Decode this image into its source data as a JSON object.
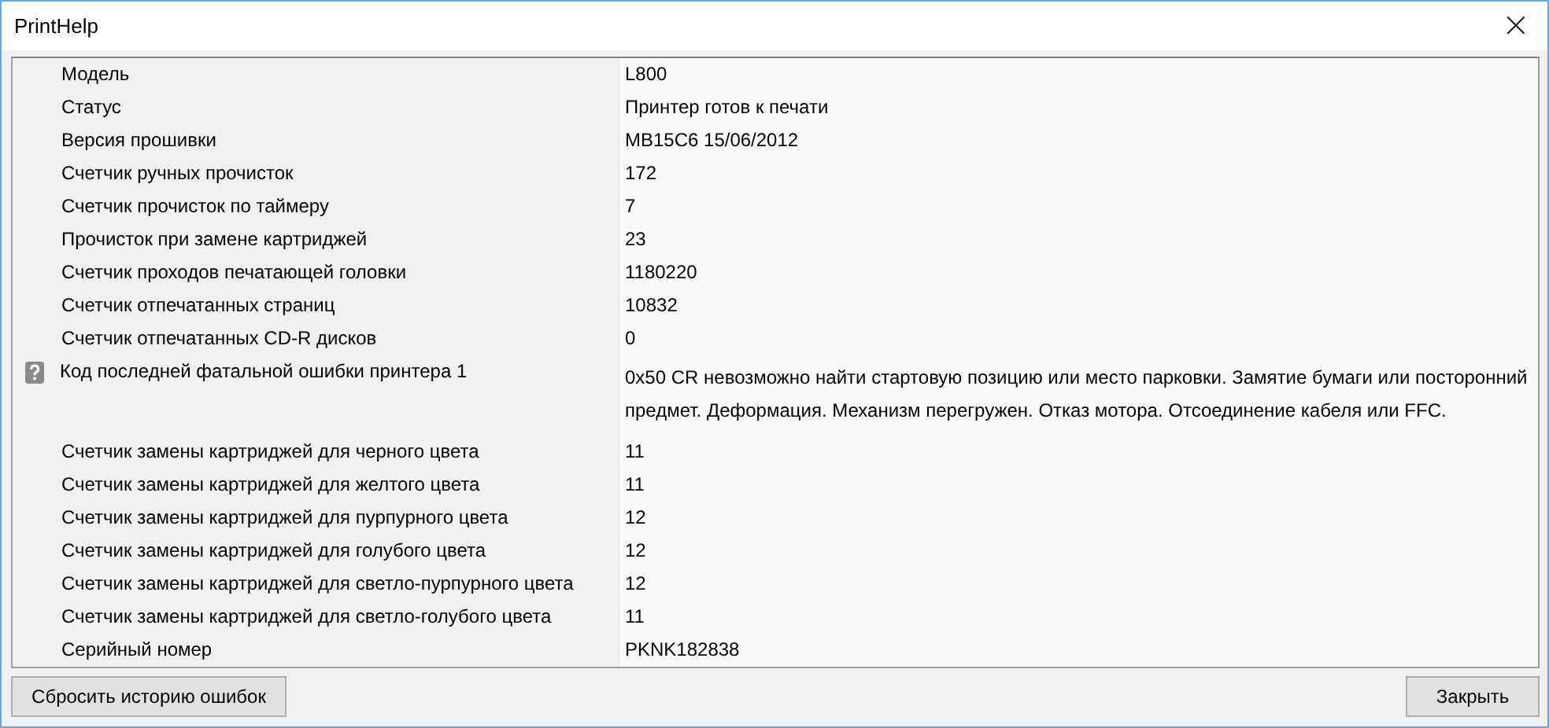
{
  "window": {
    "title": "PrintHelp",
    "close": "×"
  },
  "properties": [
    {
      "kind": "plain",
      "name": "Модель",
      "value": "L800"
    },
    {
      "kind": "plain",
      "name": "Статус",
      "value": "Принтер готов к печати"
    },
    {
      "kind": "plain",
      "name": "Версия прошивки",
      "value": "MB15C6 15/06/2012"
    },
    {
      "kind": "plain",
      "name": "Счетчик ручных прочисток",
      "value": "172"
    },
    {
      "kind": "plain",
      "name": "Счетчик прочисток по таймеру",
      "value": "7"
    },
    {
      "kind": "plain",
      "name": "Прочисток при замене картриджей",
      "value": "23"
    },
    {
      "kind": "plain",
      "name": "Счетчик проходов печатающей головки",
      "value": "1180220"
    },
    {
      "kind": "plain",
      "name": "Счетчик отпечатанных страниц",
      "value": "10832"
    },
    {
      "kind": "plain",
      "name": "Счетчик отпечатанных CD-R дисков",
      "value": "0"
    },
    {
      "kind": "help",
      "name": "Код последней фатальной ошибки принтера 1",
      "value": "0x50 CR невозможно найти стартовую позицию или место парковки. Замятие бумаги или посторонний предмет. Деформация. Механизм перегружен. Отказ мотора. Отсоединение кабеля или FFC."
    },
    {
      "kind": "plain",
      "name": "Счетчик замены картриджей для черного цвета",
      "value": "11"
    },
    {
      "kind": "plain",
      "name": "Счетчик замены картриджей для желтого цвета",
      "value": "11"
    },
    {
      "kind": "plain",
      "name": "Счетчик замены картриджей для пурпурного цвета",
      "value": "12"
    },
    {
      "kind": "plain",
      "name": "Счетчик замены картриджей для голубого цвета",
      "value": "12"
    },
    {
      "kind": "plain",
      "name": "Счетчик замены картриджей для светло-пурпурного цвета",
      "value": "12"
    },
    {
      "kind": "plain",
      "name": "Счетчик замены картриджей для светло-голубого цвета",
      "value": "11"
    },
    {
      "kind": "plain",
      "name": "Серийный номер",
      "value": "PKNK182838"
    }
  ],
  "buttons": [
    {
      "label": "Сбросить историю ошибок"
    },
    {
      "label": "Закрыть"
    }
  ]
}
